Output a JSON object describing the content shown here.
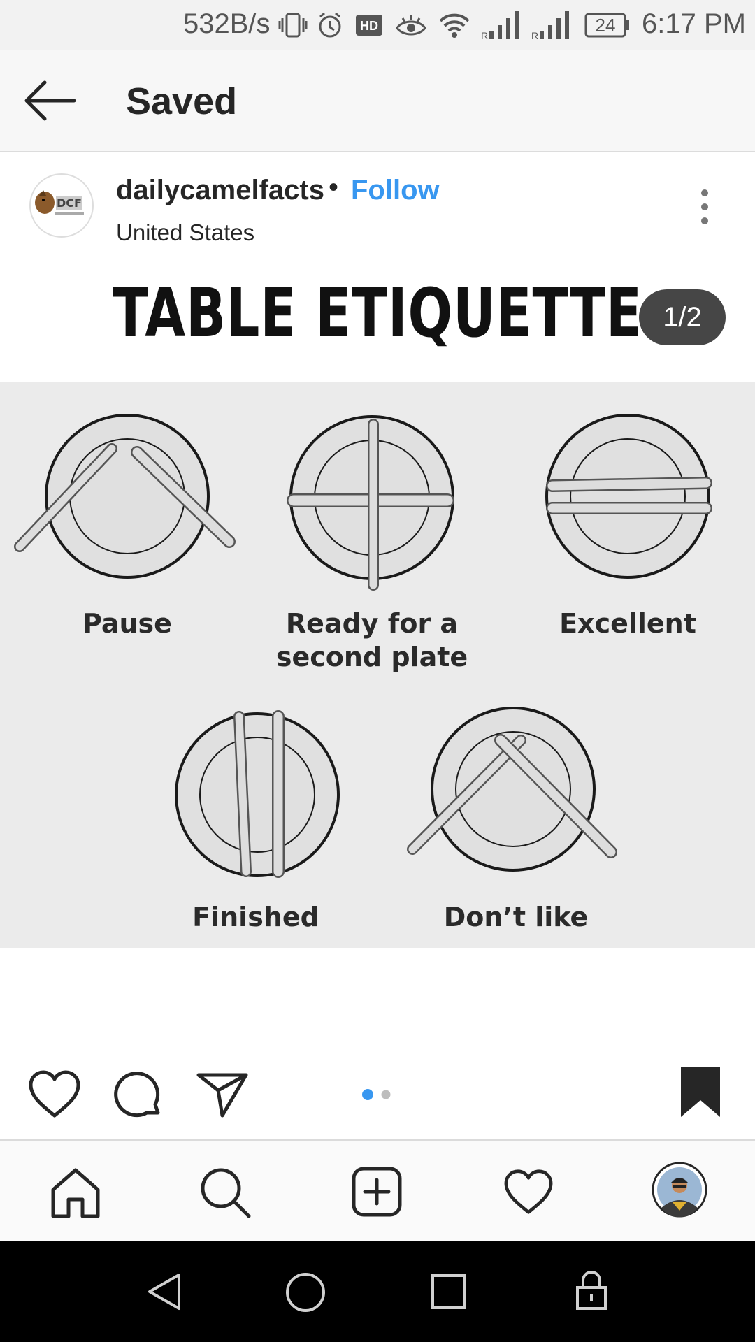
{
  "status_bar": {
    "speed": "532B/s",
    "battery": "24",
    "time": "6:17 PM"
  },
  "header": {
    "title": "Saved"
  },
  "post": {
    "username": "dailycamelfacts",
    "separator": "•",
    "follow_label": "Follow",
    "location": "United States",
    "avatar_text": "DCF",
    "image": {
      "title": "TABLE ETIQUETTE",
      "counter": "1/2",
      "captions": {
        "pause": "Pause",
        "ready_line1": "Ready for a",
        "ready_line2": "second plate",
        "excellent": "Excellent",
        "finished": "Finished",
        "dont_like": "Don’t like"
      }
    },
    "carousel": {
      "total": 2,
      "active": 1,
      "active_color": "#3897f0",
      "inactive_color": "#bdbdbd"
    }
  },
  "colors": {
    "accent": "#3897f0",
    "text": "#262626"
  },
  "icons": {
    "back": "arrow-left-icon",
    "more": "more-vertical-icon",
    "like": "heart-icon",
    "comment": "comment-icon",
    "share": "send-icon",
    "save": "bookmark-filled-icon",
    "home": "home-icon",
    "search": "search-icon",
    "add": "add-post-icon",
    "activity": "heart-icon",
    "profile": "profile-avatar"
  }
}
